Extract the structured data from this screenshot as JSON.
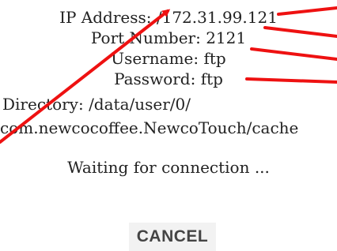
{
  "ftp_info": {
    "ip_address": "IP Address: /172.31.99.121",
    "port_number": "Port Number: 2121",
    "username": "Username: ftp",
    "password": "Password: ftp",
    "directory_line1": "Directory: /data/user/0/",
    "directory_line2": "com.newcocoffee.NewcoTouch/cache"
  },
  "status": {
    "waiting": "Waiting for connection ..."
  },
  "actions": {
    "cancel_label": "CANCEL"
  },
  "colors": {
    "annotation_red": "#ee1111",
    "text": "#222222",
    "button_text": "#444444"
  }
}
